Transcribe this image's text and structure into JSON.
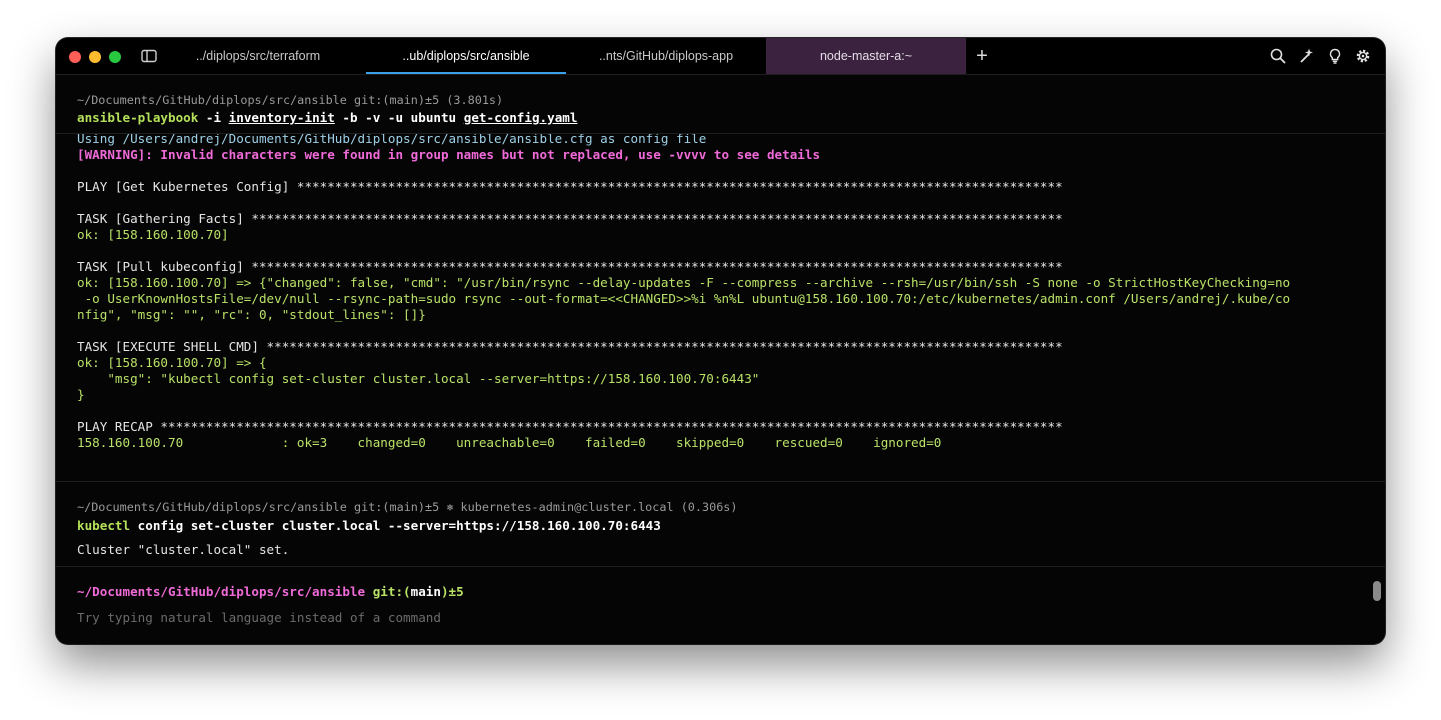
{
  "tabs": [
    {
      "label": "../diplops/src/terraform"
    },
    {
      "label": "..ub/diplops/src/ansible"
    },
    {
      "label": "..nts/GitHub/diplops-app"
    },
    {
      "label": "node-master-a:~"
    }
  ],
  "new_tab": "+",
  "block1": {
    "header": "~/Documents/GitHub/diplops/src/ansible git:(main)±5 (3.801s)",
    "cmd": {
      "bin": "ansible-playbook",
      "a1": " -i ",
      "a2": "inventory-init",
      "a3": " -b -v -u ubuntu ",
      "a4": "get-config.yaml"
    },
    "output": [
      "Using /Users/andrej/Documents/GitHub/diplops/src/ansible/ansible.cfg as config file",
      "[WARNING]: Invalid characters were found in group names but not replaced, use -vvvv to see details",
      "PLAY [Get Kubernetes Config] *****************************************************************************************************",
      "TASK [Gathering Facts] ***********************************************************************************************************",
      "ok: [158.160.100.70]",
      "TASK [Pull kubeconfig] ***********************************************************************************************************",
      "ok: [158.160.100.70] => {\"changed\": false, \"cmd\": \"/usr/bin/rsync --delay-updates -F --compress --archive --rsh=/usr/bin/ssh -S none -o StrictHostKeyChecking=no",
      " -o UserKnownHostsFile=/dev/null --rsync-path=sudo rsync --out-format=<<CHANGED>>%i %n%L ubuntu@158.160.100.70:/etc/kubernetes/admin.conf /Users/andrej/.kube/co",
      "nfig\", \"msg\": \"\", \"rc\": 0, \"stdout_lines\": []}",
      "TASK [EXECUTE SHELL CMD] *********************************************************************************************************",
      "ok: [158.160.100.70] => {",
      "    \"msg\": \"kubectl config set-cluster cluster.local --server=https://158.160.100.70:6443\"",
      "}",
      "PLAY RECAP ***********************************************************************************************************************",
      "158.160.100.70             : ok=3    changed=0    unreachable=0    failed=0    skipped=0    rescued=0    ignored=0"
    ]
  },
  "block2": {
    "header": "~/Documents/GitHub/diplops/src/ansible git:(main)±5 ⎈ kubernetes-admin@cluster.local (0.306s)",
    "cmd": {
      "bin": "kubectl",
      "rest": " config set-cluster cluster.local --server=https://158.160.100.70:6443"
    },
    "output": "Cluster \"cluster.local\" set."
  },
  "prompt": {
    "path": "~/Documents/GitHub/diplops/src/ansible",
    "git": " git:(",
    "branch": "main",
    "git_end": ")±5",
    "placeholder": "Try typing natural language instead of a command"
  },
  "colors": {
    "accent": "#3aa0e8",
    "warning": "#f06ad8",
    "ok": "#b9e267",
    "highlight_tab": "#3b2340"
  }
}
